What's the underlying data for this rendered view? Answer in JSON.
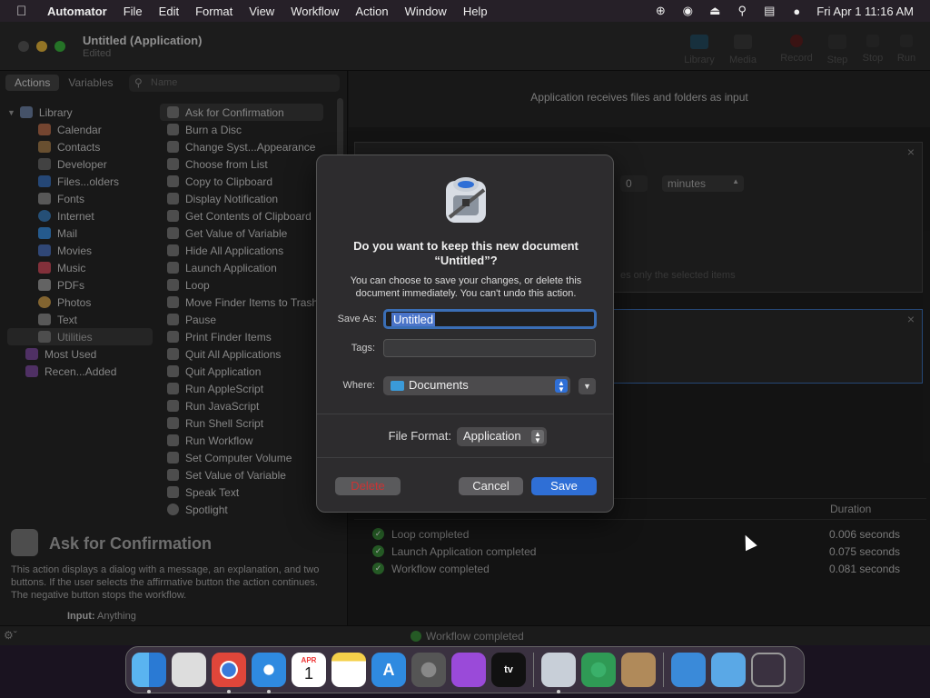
{
  "menubar": {
    "app_name": "Automator",
    "menus": [
      "File",
      "Edit",
      "Format",
      "View",
      "Workflow",
      "Action",
      "Window",
      "Help"
    ],
    "clock": "Fri Apr 1  11:16 AM"
  },
  "window": {
    "title": "Untitled (Application)",
    "subtitle": "Edited",
    "toolbar": [
      "Library",
      "Media",
      "Record",
      "Step",
      "Stop",
      "Run"
    ]
  },
  "sidebar": {
    "tabs": [
      "Actions",
      "Variables"
    ],
    "search_placeholder": "Name",
    "library_label": "Library",
    "library_items": [
      "Calendar",
      "Contacts",
      "Developer",
      "Files...olders",
      "Fonts",
      "Internet",
      "Mail",
      "Movies",
      "Music",
      "PDFs",
      "Photos",
      "Text",
      "Utilities"
    ],
    "most_used": "Most Used",
    "recently_added": "Recen...Added",
    "actions": [
      "Ask for Confirmation",
      "Burn a Disc",
      "Change Syst...Appearance",
      "Choose from List",
      "Copy to Clipboard",
      "Display Notification",
      "Get Contents of Clipboard",
      "Get Value of Variable",
      "Hide All Applications",
      "Launch Application",
      "Loop",
      "Move Finder Items to Trash",
      "Pause",
      "Print Finder Items",
      "Quit All Applications",
      "Quit Application",
      "Run AppleScript",
      "Run JavaScript",
      "Run Shell Script",
      "Run Workflow",
      "Set Computer Volume",
      "Set Value of Variable",
      "Speak Text",
      "Spotlight"
    ]
  },
  "description": {
    "title": "Ask for Confirmation",
    "text": "This action displays a dialog with a message, an explanation, and two buttons. If the user selects the affirmative button the action continues. The negative button stops the workflow.",
    "input_label": "Input:",
    "input_value": "Anything"
  },
  "workflow": {
    "header": "Application receives files and folders as input",
    "loop_unit": "minutes",
    "loop_value": "0",
    "loop_hint": "es only the selected items",
    "log_duration_header": "Duration",
    "log": [
      {
        "text": "Loop completed",
        "duration": "0.006 seconds"
      },
      {
        "text": "Launch Application completed",
        "duration": "0.075 seconds"
      },
      {
        "text": "Workflow completed",
        "duration": "0.081 seconds"
      }
    ],
    "status": "Workflow completed"
  },
  "dialog": {
    "title": "Do you want to keep this new document “Untitled”?",
    "message": "You can choose to save your changes, or delete this document immediately. You can't undo this action.",
    "save_as_label": "Save As:",
    "save_as_value": "Untitled",
    "tags_label": "Tags:",
    "where_label": "Where:",
    "where_value": "Documents",
    "file_format_label": "File Format:",
    "file_format_value": "Application",
    "delete_label": "Delete",
    "cancel_label": "Cancel",
    "save_label": "Save"
  },
  "dock": {
    "apps": [
      "finder",
      "launchpad",
      "chrome",
      "safari",
      "calendar",
      "notes",
      "app-store",
      "system-preferences",
      "podcasts",
      "apple-tv",
      "automator",
      "find-my",
      "contacts"
    ],
    "calendar_month": "APR",
    "calendar_day": "1",
    "tv_label": "tv"
  },
  "colors": {
    "accent": "#2f6fd6",
    "delete_text": "#cc3333",
    "success": "#3a8a3a"
  }
}
